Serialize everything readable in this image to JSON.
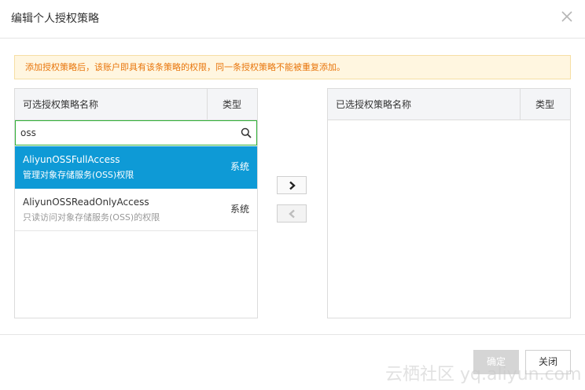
{
  "dialog": {
    "title": "编辑个人授权策略",
    "close_icon": "close-icon"
  },
  "notice": {
    "text": "添加授权策略后，该账户即具有该条策略的权限，同一条授权策略不能被重复添加。",
    "color": "#e8750b"
  },
  "available": {
    "col_name": "可选授权策略名称",
    "col_type": "类型",
    "search_value": "oss",
    "items": [
      {
        "name": "AliyunOSSFullAccess",
        "desc": "管理对象存储服务(OSS)权限",
        "type": "系统",
        "selected": true
      },
      {
        "name": "AliyunOSSReadOnlyAccess",
        "desc": "只读访问对象存储服务(OSS)的权限",
        "type": "系统",
        "selected": false
      }
    ]
  },
  "selected_panel": {
    "col_name": "已选授权策略名称",
    "col_type": "类型"
  },
  "footer": {
    "ok_label": "确定",
    "cancel_label": "关闭"
  },
  "watermark": "云栖社区 yq.aliyun.com",
  "colors": {
    "accent": "#0e9ad6",
    "search_border": "#2eb136",
    "notice_bg": "#fff6e0"
  }
}
